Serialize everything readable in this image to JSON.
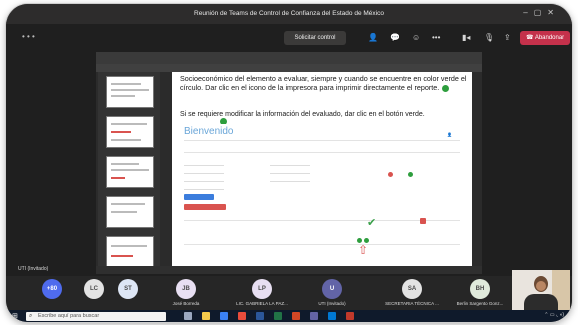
{
  "teams": {
    "title": "Reunión de Teams de Control de Confianza del Estado de México",
    "request_control": "Solicitar control",
    "leave": "Abandonar",
    "invited_label": "UTI (Invitado)"
  },
  "doc": {
    "paragraph1": "Socioeconómico del elemento a evaluar, siempre y cuando se encuentre en color verde el círculo. Dar clic en el icono de la impresora para imprimir directamente el reporte.",
    "paragraph2": "Si se requiere modificar la información del evaluado, dar clic en el botón verde."
  },
  "web": {
    "welcome": "Bienvenido"
  },
  "participants": [
    {
      "initials": "+80",
      "name": "",
      "bg": "#4f6bed",
      "fg": "#ffffff"
    },
    {
      "initials": "LC",
      "name": "",
      "bg": "#e3e3e3",
      "fg": "#4a4a4a"
    },
    {
      "initials": "ST",
      "name": "",
      "bg": "#dde6f5",
      "fg": "#4a4a4a"
    },
    {
      "initials": "JB",
      "name": "José Borreda",
      "bg": "#e8dff2",
      "fg": "#4a4a4a"
    },
    {
      "initials": "LP",
      "name": "LIC. GABRIELA LA PAZ...",
      "bg": "#e8dff2",
      "fg": "#4a4a4a"
    },
    {
      "initials": "U",
      "name": "UTI (Invitado)",
      "bg": "#6264a7",
      "fg": "#ffffff"
    },
    {
      "initials": "SA",
      "name": "SECRETARIA TÉCNICA ...",
      "bg": "#e3e3e3",
      "fg": "#4a4a4a"
    },
    {
      "initials": "BH",
      "name": "Berlin Sargento Gonz...",
      "bg": "#e0eadc",
      "fg": "#4a4a4a"
    }
  ],
  "taskbar": {
    "search_placeholder": "Escribe aquí para buscar"
  },
  "colors": {
    "leave_red": "#c4314b",
    "status_green": "#2e9e3e",
    "link_blue": "#6aa6d8"
  }
}
